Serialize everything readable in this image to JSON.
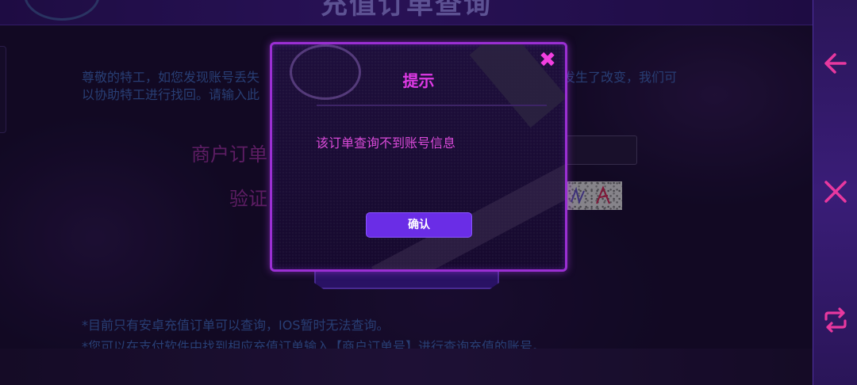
{
  "header": {
    "title": "充值订单查询"
  },
  "main": {
    "intro_line1": "尊敬的特工，如您发现账号丢失",
    "intro_line1_tail": "录方式发生了改变，我们可",
    "intro_line2": "以协助特工进行找回。请输入此",
    "order_label": "商户订单",
    "code_label": "验证",
    "notes": [
      "*目前只有安卓充值订单可以查询，IOS暂时无法查询。",
      "*您可以在支付软件中找到相应充值订单输入【商户订单号】进行查询充值的账号。"
    ]
  },
  "dialog": {
    "title": "提示",
    "close_icon": "✖",
    "message": "该订单查询不到账号信息",
    "confirm_label": "确认"
  },
  "sidebar": {
    "icons": [
      "back-arrow-icon",
      "close-icon",
      "switch-icon"
    ],
    "accent": "#e8389f"
  },
  "colors": {
    "dialog_border": "#9b2fd3",
    "dialog_title": "#e03ae6",
    "confirm_button": "#6a2de6",
    "info_text": "#3a5fa8"
  }
}
